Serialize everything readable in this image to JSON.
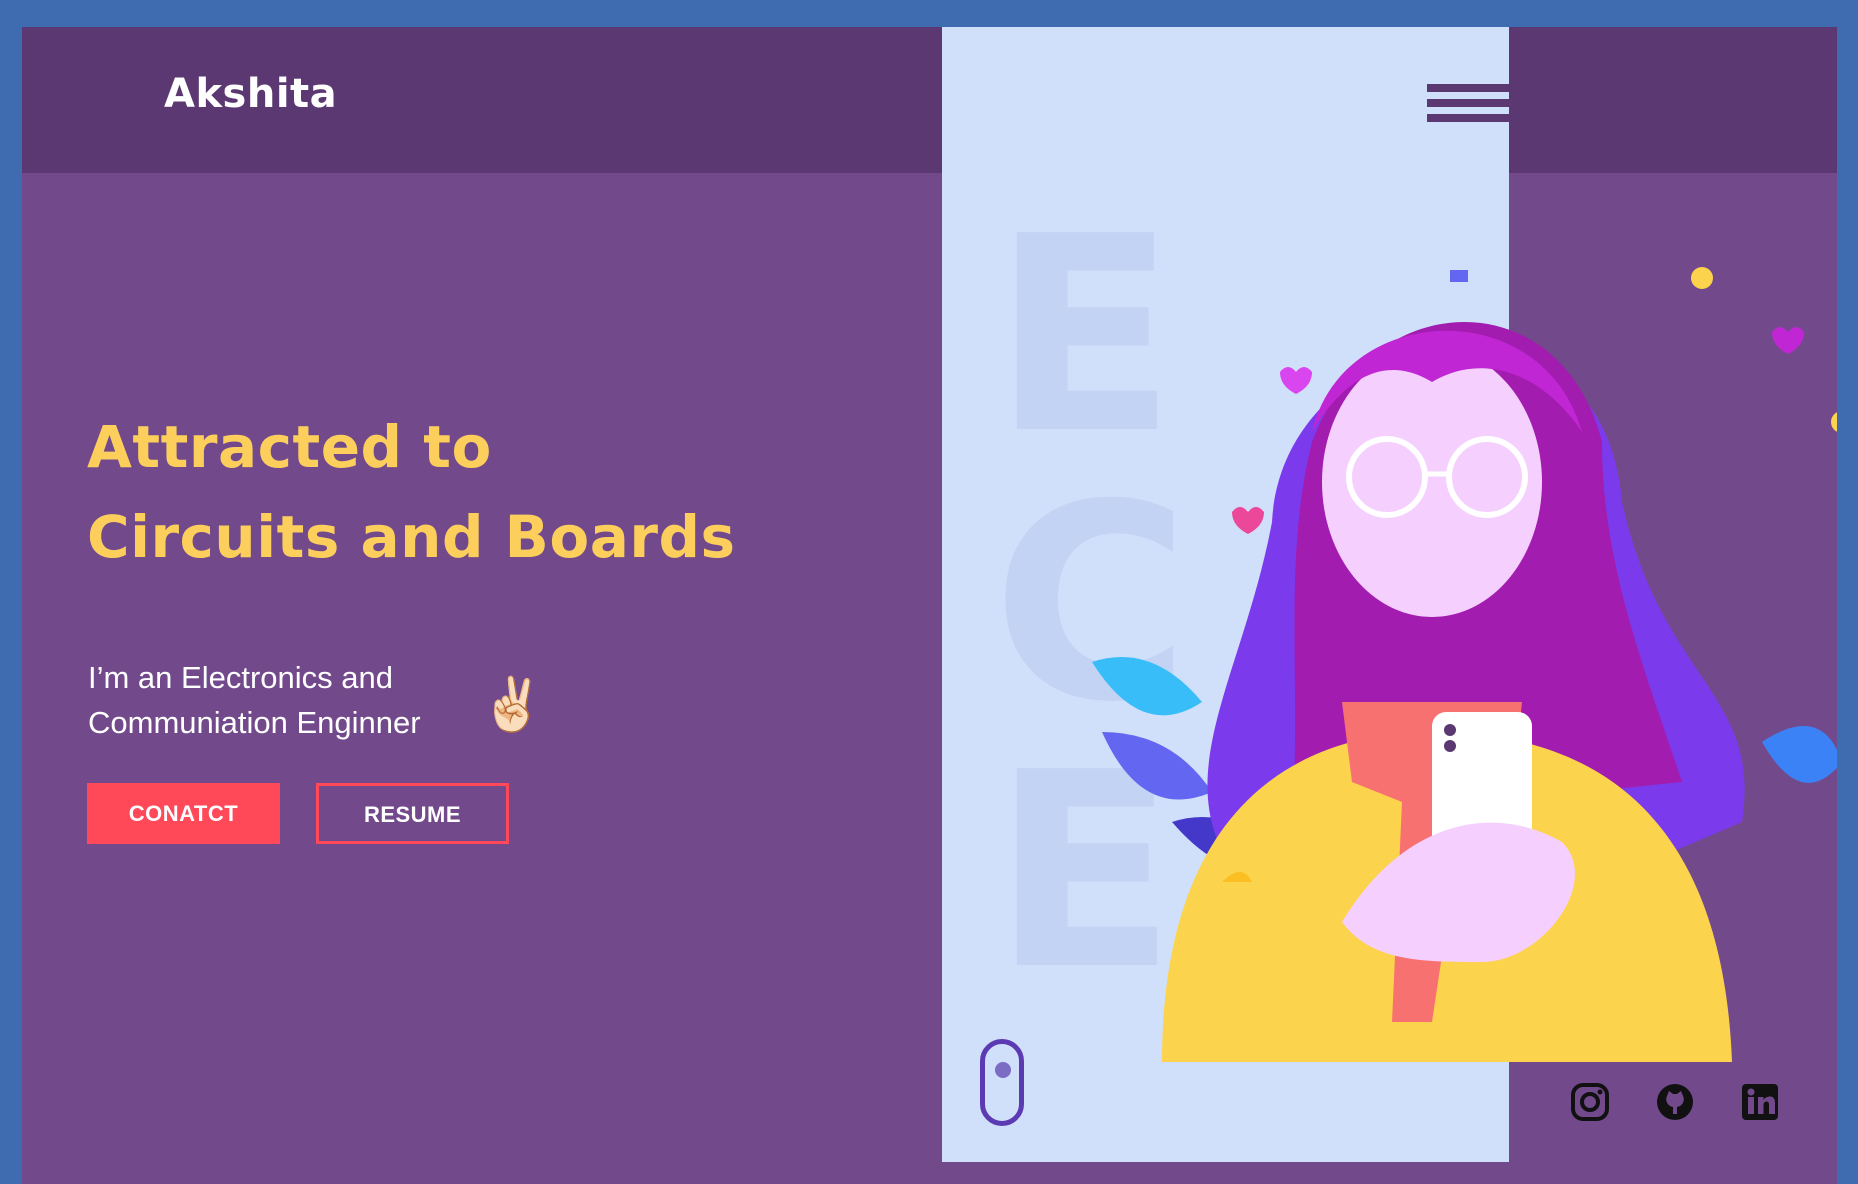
{
  "brand": {
    "name": "Akshita"
  },
  "nav": {
    "menu_icon": "hamburger-menu-icon"
  },
  "panel": {
    "letters": [
      "E",
      "C",
      "E"
    ]
  },
  "hero": {
    "title_line1": "Attracted to",
    "title_line2": "Circuits and Boards",
    "subtitle_line1": "I’m an Electronics and",
    "subtitle_line2": "Communiation Enginner",
    "emoji": "✌🏻",
    "contact_label": "CONATCT",
    "resume_label": "RESUME"
  },
  "social": [
    {
      "icon": "instagram-icon"
    },
    {
      "icon": "github-icon"
    },
    {
      "icon": "linkedin-icon"
    }
  ],
  "colors": {
    "frame": "#3f6bb0",
    "background": "#724a8c",
    "topbar": "#5b3872",
    "panel": "#d0e0fb",
    "accent_yellow": "#fccf5c",
    "accent_red": "#ff4858"
  }
}
